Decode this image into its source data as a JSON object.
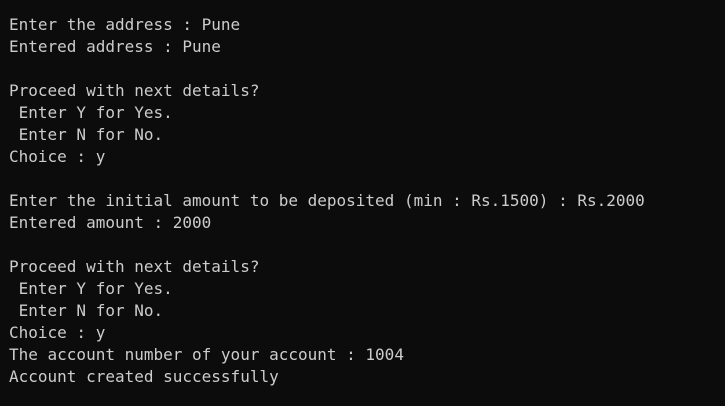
{
  "terminal": {
    "lines": [
      "Enter the address : Pune",
      "Entered address : Pune",
      "",
      "Proceed with next details?",
      " Enter Y for Yes.",
      " Enter N for No.",
      "Choice : y",
      "",
      "Enter the initial amount to be deposited (min : Rs.1500) : Rs.2000",
      "Entered amount : 2000",
      "",
      "Proceed with next details?",
      " Enter Y for Yes.",
      " Enter N for No.",
      "Choice : y",
      "The account number of your account : 1004",
      "Account created successfully"
    ]
  },
  "colors": {
    "background": "#0c0c0c",
    "text": "#cccccc"
  }
}
